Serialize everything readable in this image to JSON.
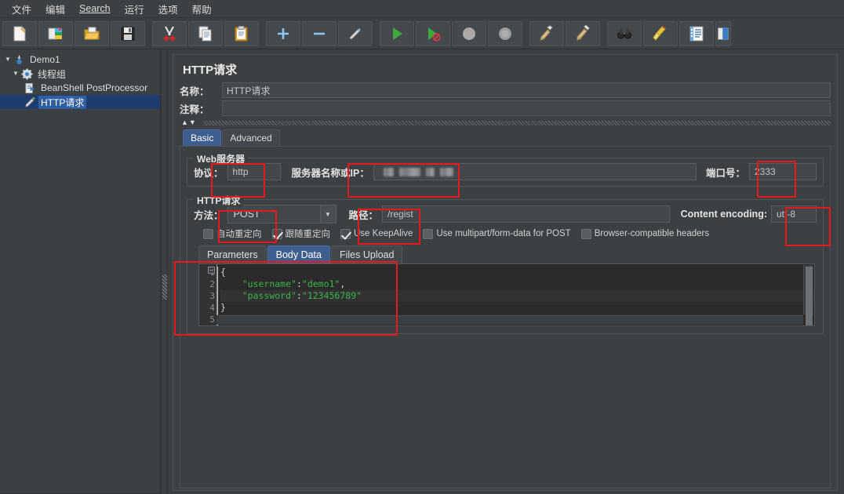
{
  "menubar": {
    "items": [
      {
        "label": "文件"
      },
      {
        "label": "编辑"
      },
      {
        "label": "Search",
        "mnemonic": "S"
      },
      {
        "label": "运行"
      },
      {
        "label": "选项"
      },
      {
        "label": "帮助"
      }
    ]
  },
  "toolbar": {
    "buttons": [
      {
        "name": "new-icon",
        "tip": "新建"
      },
      {
        "name": "templates-icon",
        "tip": "模板"
      },
      {
        "name": "open-icon",
        "tip": "打开"
      },
      {
        "name": "save-icon",
        "tip": "保存"
      },
      {
        "name": "cut-icon",
        "tip": "剪切"
      },
      {
        "name": "copy-icon",
        "tip": "复制"
      },
      {
        "name": "paste-icon",
        "tip": "粘贴"
      },
      {
        "name": "expand-all-icon",
        "tip": "展开"
      },
      {
        "name": "collapse-all-icon",
        "tip": "收起"
      },
      {
        "name": "toggle-icon",
        "tip": "启用/禁用"
      },
      {
        "name": "start-icon",
        "tip": "启动"
      },
      {
        "name": "start-no-pauses-icon",
        "tip": "无间隔启动"
      },
      {
        "name": "stop-icon",
        "tip": "停止"
      },
      {
        "name": "shutdown-icon",
        "tip": "关闭"
      },
      {
        "name": "clear-icon",
        "tip": "清除"
      },
      {
        "name": "clear-all-icon",
        "tip": "清除全部"
      },
      {
        "name": "search-icon",
        "tip": "搜索"
      },
      {
        "name": "reset-search-icon",
        "tip": "重置搜索"
      },
      {
        "name": "function-helper-icon",
        "tip": "函数助手"
      },
      {
        "name": "help-icon",
        "tip": "帮助"
      }
    ]
  },
  "tree": {
    "nodes": [
      {
        "label": "Demo1",
        "icon": "test-plan-icon",
        "indent": 0,
        "twisty": "▼",
        "selected": false
      },
      {
        "label": "线程组",
        "icon": "thread-group-icon",
        "indent": 1,
        "twisty": "▼",
        "selected": false
      },
      {
        "label": "BeanShell PostProcessor",
        "icon": "post-processor-icon",
        "indent": 2,
        "twisty": "",
        "selected": false
      },
      {
        "label": "HTTP请求",
        "icon": "http-sampler-icon",
        "indent": 2,
        "twisty": "",
        "selected": true
      }
    ]
  },
  "panel": {
    "title": "HTTP请求",
    "name_label": "名称：",
    "name_value": "HTTP请求",
    "comment_label": "注释：",
    "comment_value": "",
    "comment_placeholder": ""
  },
  "tabs": [
    {
      "label": "Basic",
      "active": true
    },
    {
      "label": "Advanced",
      "active": false
    }
  ],
  "web_server": {
    "group_title": "Web服务器",
    "protocol_label": "协议：",
    "protocol_value": "http",
    "server_label": "服务器名称或IP：",
    "server_value": "",
    "server_redacted": true,
    "port_label": "端口号：",
    "port_value": "2333"
  },
  "http_request": {
    "group_title": "HTTP请求",
    "method_label": "方法：",
    "method_value": "POST",
    "path_label": "路径：",
    "path_value": "/regist",
    "encoding_label": "Content encoding:",
    "encoding_value": "utf-8",
    "checkboxes": [
      {
        "label": "自动重定向",
        "checked": false
      },
      {
        "label": "跟随重定向",
        "checked": true
      },
      {
        "label": "Use KeepAlive",
        "checked": true
      },
      {
        "label": "Use multipart/form-data for POST",
        "checked": false
      },
      {
        "label": "Browser-compatible headers",
        "checked": false
      }
    ]
  },
  "body_tabs": [
    {
      "label": "Parameters",
      "active": false
    },
    {
      "label": "Body Data",
      "active": true
    },
    {
      "label": "Files Upload",
      "active": false
    }
  ],
  "editor": {
    "line_numbers": [
      "1",
      "2",
      "3",
      "4",
      "5"
    ],
    "fold_marker": "–",
    "lines": [
      "{",
      "    \"username\":\"demo1\",",
      "    \"password\":\"123456789\"",
      "}",
      ""
    ],
    "raw_text": "{\n    \"username\":\"demo1\",\n    \"password\":\"123456789\"\n}\n"
  },
  "annotations": {
    "color": "#e8191b",
    "boxes": [
      {
        "name": "protocol-highlight"
      },
      {
        "name": "server-highlight"
      },
      {
        "name": "port-highlight"
      },
      {
        "name": "method-highlight"
      },
      {
        "name": "path-highlight"
      },
      {
        "name": "encoding-highlight"
      },
      {
        "name": "body-data-highlight"
      }
    ]
  }
}
